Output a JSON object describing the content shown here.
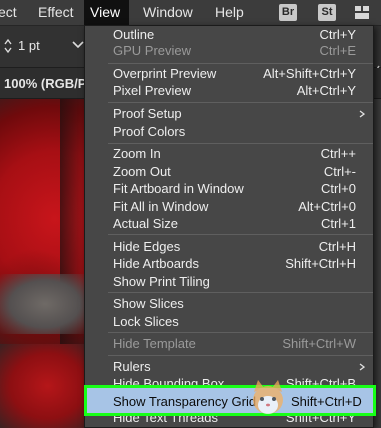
{
  "menubar": {
    "items": [
      {
        "label": "ect"
      },
      {
        "label": "Effect"
      },
      {
        "label": "View"
      },
      {
        "label": "Window"
      },
      {
        "label": "Help"
      }
    ],
    "badges": [
      "Br",
      "St"
    ]
  },
  "controlbar": {
    "stroke_weight": "1 pt"
  },
  "document": {
    "tab_title": "100% (RGB/Pr"
  },
  "view_menu": {
    "items": [
      {
        "label": "Outline",
        "shortcut": "Ctrl+Y",
        "enabled": true
      },
      {
        "label": "GPU Preview",
        "shortcut": "Ctrl+E",
        "enabled": false
      },
      {
        "label": "Overprint Preview",
        "shortcut": "Alt+Shift+Ctrl+Y",
        "enabled": true
      },
      {
        "label": "Pixel Preview",
        "shortcut": "Alt+Ctrl+Y",
        "enabled": true
      },
      {
        "label": "Proof Setup",
        "shortcut": "",
        "enabled": true,
        "submenu": true
      },
      {
        "label": "Proof Colors",
        "shortcut": "",
        "enabled": true
      },
      {
        "label": "Zoom In",
        "shortcut": "Ctrl++",
        "enabled": true
      },
      {
        "label": "Zoom Out",
        "shortcut": "Ctrl+-",
        "enabled": true
      },
      {
        "label": "Fit Artboard in Window",
        "shortcut": "Ctrl+0",
        "enabled": true
      },
      {
        "label": "Fit All in Window",
        "shortcut": "Alt+Ctrl+0",
        "enabled": true
      },
      {
        "label": "Actual Size",
        "shortcut": "Ctrl+1",
        "enabled": true
      },
      {
        "label": "Hide Edges",
        "shortcut": "Ctrl+H",
        "enabled": true
      },
      {
        "label": "Hide Artboards",
        "shortcut": "Shift+Ctrl+H",
        "enabled": true
      },
      {
        "label": "Show Print Tiling",
        "shortcut": "",
        "enabled": true
      },
      {
        "label": "Show Slices",
        "shortcut": "",
        "enabled": true
      },
      {
        "label": "Lock Slices",
        "shortcut": "",
        "enabled": true
      },
      {
        "label": "Hide Template",
        "shortcut": "Shift+Ctrl+W",
        "enabled": false
      },
      {
        "label": "Rulers",
        "shortcut": "",
        "enabled": true,
        "submenu": true
      },
      {
        "label": "Hide Bounding Box",
        "shortcut": "Shift+Ctrl+B",
        "enabled": true
      },
      {
        "label": "Show Transparency Grid",
        "shortcut": "Shift+Ctrl+D",
        "enabled": true,
        "highlighted": true
      },
      {
        "label": "Hide Text Threads",
        "shortcut": "Shift+Ctrl+Y",
        "enabled": true
      }
    ]
  },
  "colors": {
    "highlight_border": "#17ff17",
    "highlight_fill": "#a7c4e6",
    "menu_bg": "#474747",
    "canvas_red": "#c8151b"
  }
}
